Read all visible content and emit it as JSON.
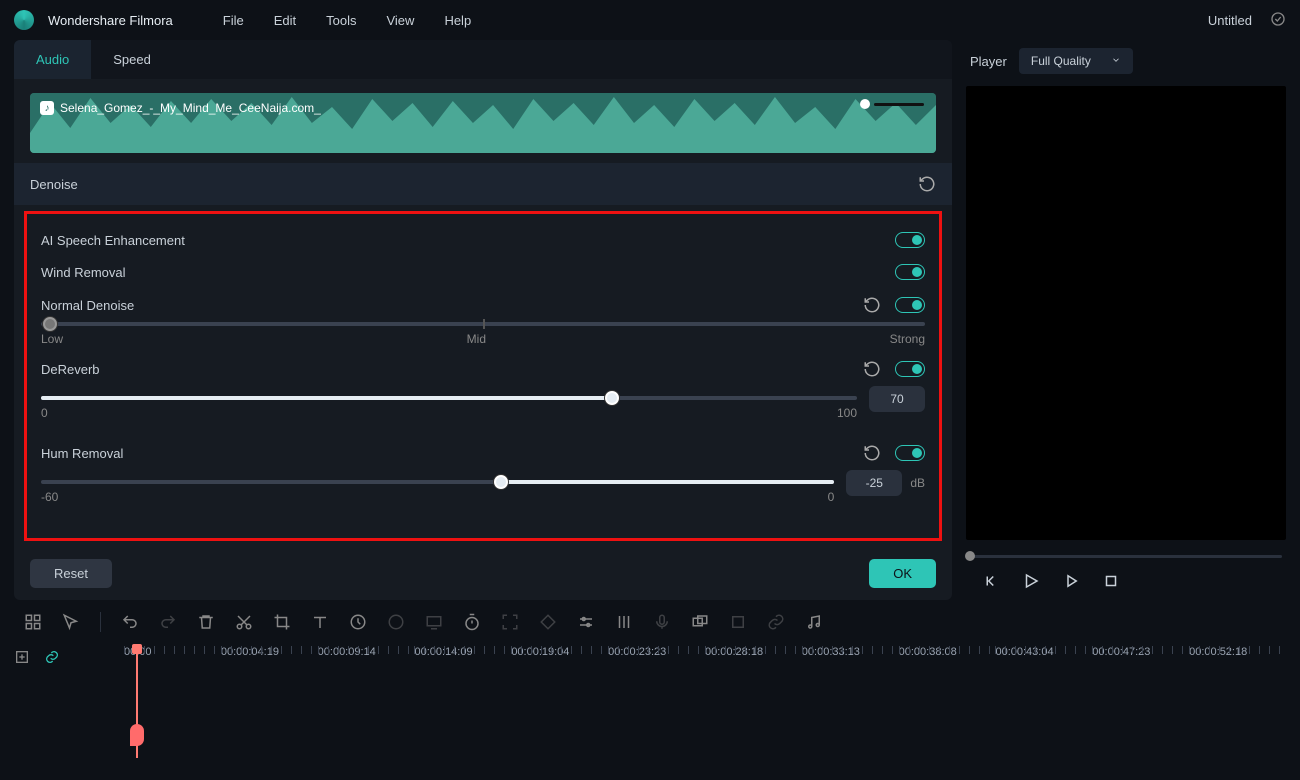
{
  "app": {
    "title": "Wondershare Filmora"
  },
  "menu": [
    "File",
    "Edit",
    "Tools",
    "View",
    "Help"
  ],
  "doc": {
    "title": "Untitled"
  },
  "tabs": {
    "audio": "Audio",
    "speed": "Speed"
  },
  "clip": {
    "name": "Selena_Gomez_-_My_Mind_Me_CeeNaija.com_"
  },
  "section": {
    "title": "Denoise"
  },
  "ai_speech": {
    "label": "AI Speech Enhancement"
  },
  "wind": {
    "label": "Wind Removal"
  },
  "normal": {
    "label": "Normal Denoise",
    "low": "Low",
    "mid": "Mid",
    "strong": "Strong",
    "value_pct": 0
  },
  "dereverb": {
    "label": "DeReverb",
    "min": "0",
    "max": "100",
    "value": "70",
    "value_pct": 70
  },
  "hum": {
    "label": "Hum Removal",
    "min": "-60",
    "max": "0",
    "value": "-25",
    "unit": "dB",
    "value_pct": 58
  },
  "buttons": {
    "reset": "Reset",
    "ok": "OK"
  },
  "player": {
    "label": "Player",
    "quality": "Full Quality"
  },
  "timecodes": [
    "00:00",
    "00:00:04:19",
    "00:00:09:14",
    "00:00:14:09",
    "00:00:19:04",
    "00:00:23:23",
    "00:00:28:18",
    "00:00:33:13",
    "00:00:38:08",
    "00:00:43:04",
    "00:00:47:23",
    "00:00:52:18"
  ]
}
